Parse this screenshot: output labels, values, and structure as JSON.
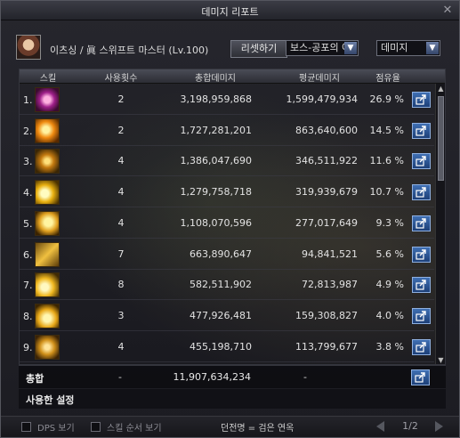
{
  "window": {
    "title": "데미지 리포트",
    "close_label": "✕"
  },
  "character": {
    "name": "이츠싱 / 眞 스위프트 마스터 (Lv.100)"
  },
  "toolbar": {
    "reset_label": "리셋하기",
    "boss_select": "보스-공포의 아...",
    "type_select": "데미지"
  },
  "table": {
    "headers": [
      "스킬",
      "사용횟수",
      "총합데미지",
      "평균데미지",
      "점유율"
    ],
    "rows": [
      {
        "rank": "1.",
        "icon": "skill-icon-1",
        "uses": "2",
        "total": "3,198,959,868",
        "average": "1,599,479,934",
        "share": "26.9 %"
      },
      {
        "rank": "2.",
        "icon": "skill-icon-2",
        "uses": "2",
        "total": "1,727,281,201",
        "average": "863,640,600",
        "share": "14.5 %"
      },
      {
        "rank": "3.",
        "icon": "skill-icon-3",
        "uses": "4",
        "total": "1,386,047,690",
        "average": "346,511,922",
        "share": "11.6 %"
      },
      {
        "rank": "4.",
        "icon": "skill-icon-4",
        "uses": "4",
        "total": "1,279,758,718",
        "average": "319,939,679",
        "share": "10.7 %"
      },
      {
        "rank": "5.",
        "icon": "skill-icon-5",
        "uses": "4",
        "total": "1,108,070,596",
        "average": "277,017,649",
        "share": "9.3 %"
      },
      {
        "rank": "6.",
        "icon": "skill-icon-6",
        "uses": "7",
        "total": "663,890,647",
        "average": "94,841,521",
        "share": "5.6 %"
      },
      {
        "rank": "7.",
        "icon": "skill-icon-7",
        "uses": "8",
        "total": "582,511,902",
        "average": "72,813,987",
        "share": "4.9 %"
      },
      {
        "rank": "8.",
        "icon": "skill-icon-8",
        "uses": "3",
        "total": "477,926,481",
        "average": "159,308,827",
        "share": "4.0 %"
      },
      {
        "rank": "9.",
        "icon": "skill-icon-9",
        "uses": "4",
        "total": "455,198,710",
        "average": "113,799,677",
        "share": "3.8 %"
      }
    ]
  },
  "total": {
    "label": "총합",
    "uses": "-",
    "total": "11,907,634,234",
    "average": "-"
  },
  "used_settings": {
    "label": "사용한 설정"
  },
  "bottom": {
    "dps_label": "DPS 보기",
    "order_label": "스킬 순서 보기",
    "legend": "던전명 = 검은 연옥",
    "page": "1/2"
  },
  "colors": {
    "share_button": "#2a5599",
    "header": "#3a3b44",
    "accent_blue": "#6c7fa6"
  }
}
